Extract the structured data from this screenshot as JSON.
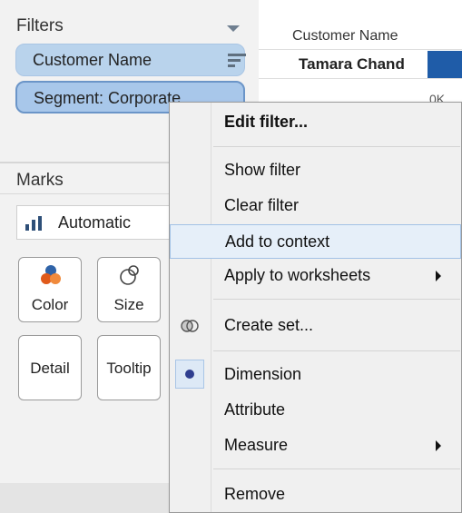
{
  "filters": {
    "title": "Filters",
    "pills": [
      {
        "label": "Customer Name"
      },
      {
        "label": "Segment: Corporate"
      }
    ]
  },
  "marks": {
    "title": "Marks",
    "mark_type": "Automatic",
    "cards": [
      {
        "label": "Color"
      },
      {
        "label": "Size"
      },
      {
        "label": "Detail"
      },
      {
        "label": "Tooltip"
      }
    ]
  },
  "view": {
    "column_header": "Customer Name",
    "row_label": "Tamara Chand",
    "axis_tick_peek": "0K"
  },
  "context_menu": {
    "items": [
      {
        "label": "Edit filter..."
      },
      {
        "label": "Show filter"
      },
      {
        "label": "Clear filter"
      },
      {
        "label": "Add to context"
      },
      {
        "label": "Apply to worksheets"
      },
      {
        "label": "Create set..."
      },
      {
        "label": "Dimension"
      },
      {
        "label": "Attribute"
      },
      {
        "label": "Measure"
      },
      {
        "label": "Remove"
      }
    ]
  },
  "colors": {
    "pill_bg": "#b9d3ec",
    "pill_active_border": "#6b95c8",
    "menu_highlight": "#e6eff9",
    "bar": "#1f5ca8"
  },
  "icons": {
    "filters_menu": "caret-down-icon",
    "sort": "sort-descending-icon",
    "mark_type": "bar-chart-icon",
    "color": "color-icon",
    "size": "size-icon",
    "create_set": "set-icon",
    "dimension_selected": "radio-dot-icon"
  }
}
